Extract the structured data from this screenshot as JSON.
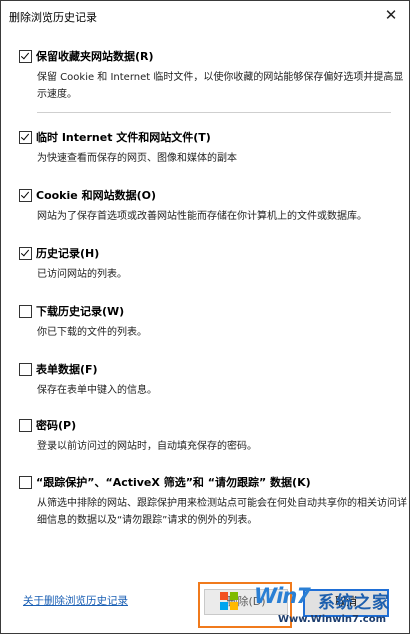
{
  "dialog": {
    "title": "删除浏览历史记录",
    "close_glyph": "✕"
  },
  "options": [
    {
      "label": "保留收藏夹网站数据(R)",
      "checked": true,
      "description": "保留 Cookie 和 Internet 临时文件，以使你收藏的网站能够保存偏好选项并提高显示速度。"
    },
    {
      "label": "临时 Internet 文件和网站文件(T)",
      "checked": true,
      "description": "为快速查看而保存的网页、图像和媒体的副本"
    },
    {
      "label": "Cookie 和网站数据(O)",
      "checked": true,
      "description": "网站为了保存首选项或改善网站性能而存储在你计算机上的文件或数据库。"
    },
    {
      "label": "历史记录(H)",
      "checked": true,
      "description": "已访问网站的列表。"
    },
    {
      "label": "下载历史记录(W)",
      "checked": false,
      "description": "你已下载的文件的列表。"
    },
    {
      "label": "表单数据(F)",
      "checked": false,
      "description": "保存在表单中键入的信息。"
    },
    {
      "label": "密码(P)",
      "checked": false,
      "description": "登录以前访问过的网站时，自动填充保存的密码。"
    },
    {
      "label": "“跟踪保护”、“ActiveX 筛选”和 “请勿跟踪” 数据(K)",
      "checked": false,
      "description": "从筛选中排除的网站、跟踪保护用来检测站点可能会在何处自动共享你的相关访问详细信息的数据以及“请勿跟踪”请求的例外的列表。"
    }
  ],
  "footer": {
    "about_link": "关于删除浏览历史记录",
    "delete_button": "删除(D)",
    "cancel_button": "取消"
  },
  "watermark": {
    "brand": "Win7",
    "brand_cn": "系统之家",
    "url": "Www.Winwin7.com",
    "colors": {
      "border": "#f07a1c",
      "text": "#2a7fd4"
    }
  }
}
